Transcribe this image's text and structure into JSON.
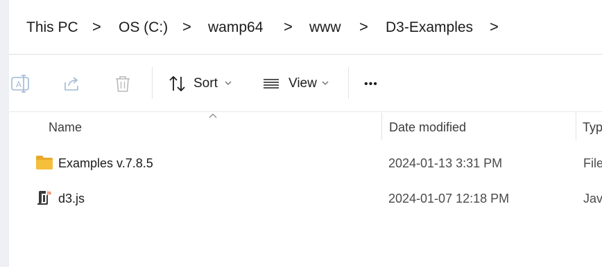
{
  "breadcrumb": {
    "items": [
      "This PC",
      "OS (C:)",
      "wamp64",
      "www",
      "D3-Examples"
    ],
    "separator": ">"
  },
  "toolbar": {
    "rename_icon": "rename-icon",
    "share_icon": "share-icon",
    "delete_icon": "trash-icon",
    "sort_label": "Sort",
    "view_label": "View",
    "more_label": "•••"
  },
  "columns": {
    "name": "Name",
    "date_modified": "Date modified",
    "type": "Typ"
  },
  "files": [
    {
      "icon": "folder-icon",
      "name": "Examples v.7.8.5",
      "date": "2024-01-13 3:31 PM",
      "type": "File"
    },
    {
      "icon": "js-file-icon",
      "name": "d3.js",
      "date": "2024-01-07 12:18 PM",
      "type": "Java"
    }
  ],
  "colors": {
    "folder": "#f4bf3a",
    "disabled_icon": "#9fb8d6",
    "accent": "#0067c0"
  }
}
